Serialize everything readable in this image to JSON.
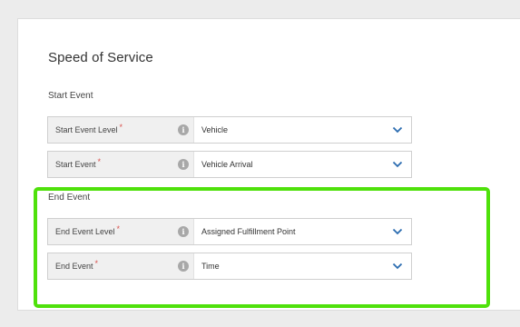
{
  "page": {
    "title": "Speed of Service"
  },
  "start_event": {
    "section_label": "Start Event",
    "fields": [
      {
        "label": "Start Event Level",
        "required_marker": "*",
        "value": "Vehicle"
      },
      {
        "label": "Start Event",
        "required_marker": "*",
        "value": "Vehicle Arrival"
      }
    ]
  },
  "end_event": {
    "section_label": "End Event",
    "fields": [
      {
        "label": "End Event Level",
        "required_marker": "*",
        "value": "Assigned Fulfillment Point"
      },
      {
        "label": "End Event",
        "required_marker": "*",
        "value": "Time"
      }
    ]
  },
  "icons": {
    "info": "info-icon",
    "dropdown": "chevron-down-icon",
    "info_glyph": "i"
  },
  "colors": {
    "highlight_border": "#4fe10b",
    "required_marker": "#d9534f",
    "chevron": "#2b6cb0"
  }
}
